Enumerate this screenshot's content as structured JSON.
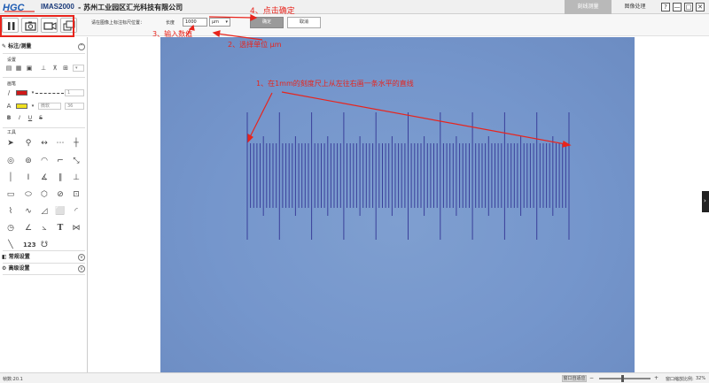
{
  "titlebar": {
    "logo_text": "HGC",
    "app_name": "IMAS2000",
    "company": "-  苏州工业园区汇光科技有限公司",
    "tabs": [
      {
        "label": "刻线测量",
        "active": true
      },
      {
        "label": "图像处理",
        "active": false
      }
    ],
    "window_buttons": {
      "help": "?",
      "minimize": "—",
      "maximize": "□",
      "close": "✕"
    }
  },
  "calibration": {
    "prompt": "请在图像上标注标尺位置：",
    "length_label": "长度",
    "length_value": "1000",
    "unit_value": "μm",
    "ok_label": "确定",
    "cancel_label": "取消"
  },
  "left_panel": {
    "annotate_title": "标注/测量",
    "settings_label": "设置",
    "brush_label": "画笔",
    "tools_label": "工具",
    "brush_color": "#d01818",
    "fill_color": "#f0e020",
    "line_width": "1",
    "font_size": "36",
    "font_name": "微软",
    "text_style": [
      "B",
      "I",
      "U",
      "S"
    ],
    "common_settings": "常规设置",
    "advanced_settings": "高级设置"
  },
  "annotations": {
    "step1": "1、在1mm的刻度尺上从左往右画一条水平的直线",
    "step2": "2、选择单位 μm",
    "step3": "3、输入数值",
    "step4": "4、点击确定",
    "color": "#e8241c"
  },
  "statusbar": {
    "left": "帧数:20.1",
    "fit_label": "窗口自适应",
    "zoom_label": "窗口缩放比例:",
    "zoom_value": "32%"
  }
}
